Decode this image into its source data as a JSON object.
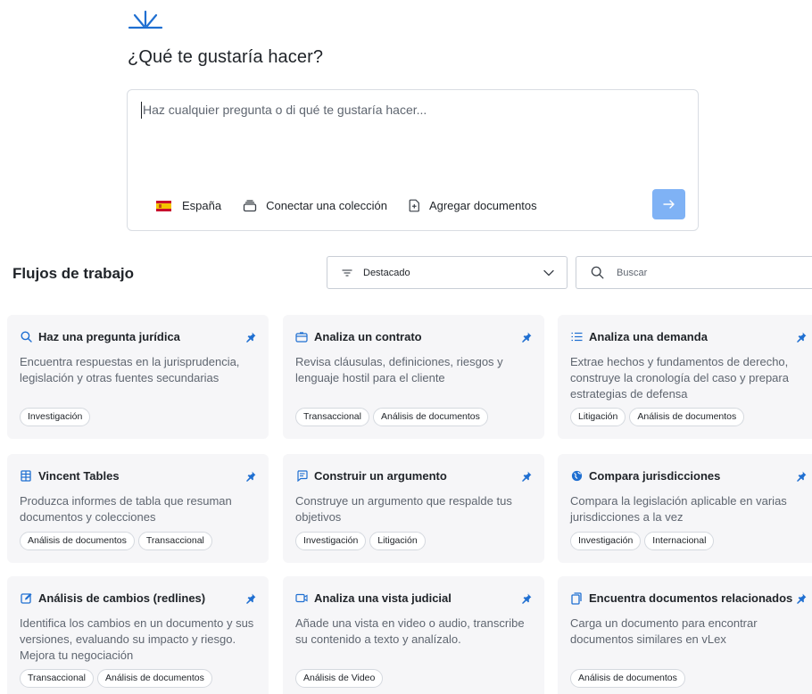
{
  "header": {
    "logo_icon": "vlex-spark-logo-icon",
    "title": "¿Qué te gustaría hacer?"
  },
  "prompt": {
    "placeholder": "Haz cualquier pregunta o di qué te gustaría hacer...",
    "tools": {
      "jurisdiction": "España",
      "collection": "Conectar una colección",
      "documents": "Agregar documentos"
    },
    "send_icon": "arrow-right-icon"
  },
  "workflows": {
    "title": "Flujos de trabajo",
    "sort": {
      "value": "Destacado",
      "icon": "filter-lines-icon"
    },
    "search": {
      "placeholder": "Buscar",
      "icon": "search-icon"
    },
    "cards": [
      {
        "title": "Haz una pregunta jurídica",
        "icon": "search-icon",
        "desc": "Encuentra respuestas en la jurisprudencia, legislación y otras fuentes secundarias",
        "tags": [
          "Investigación"
        ]
      },
      {
        "title": "Analiza un contrato",
        "icon": "contract-icon",
        "desc": "Revisa cláusulas, definiciones, riesgos y lenguaje hostil para el cliente",
        "tags": [
          "Transaccional",
          "Análisis de documentos"
        ]
      },
      {
        "title": "Analiza una demanda",
        "icon": "list-icon",
        "desc": "Extrae hechos y fundamentos de derecho, construye la cronología del caso y prepara estrategias de defensa",
        "tags": [
          "Litigación",
          "Análisis de documentos"
        ]
      },
      {
        "title": "Vincent Tables",
        "icon": "table-icon",
        "desc": "Produzca informes de tabla que resuman documentos y colecciones",
        "tags": [
          "Análisis de documentos",
          "Transaccional"
        ]
      },
      {
        "title": "Construir un argumento",
        "icon": "message-icon",
        "desc": "Construye un argumento que respalde tus objetivos",
        "tags": [
          "Investigación",
          "Litigación"
        ]
      },
      {
        "title": "Compara jurisdicciones",
        "icon": "globe-icon",
        "desc": "Compara la legislación aplicable en varias jurisdicciones a la vez",
        "tags": [
          "Investigación",
          "Internacional"
        ]
      },
      {
        "title": "Análisis de cambios (redlines)",
        "icon": "edit-icon",
        "desc": "Identifica los cambios en un documento y sus versiones, evaluando su impacto y riesgo. Mejora tu negociación",
        "tags": [
          "Transaccional",
          "Análisis de documentos"
        ]
      },
      {
        "title": "Analiza una vista judicial",
        "icon": "video-icon",
        "desc": "Añade una vista en video o audio, transcribe su contenido a texto y analízalo.",
        "tags": [
          "Análisis de Video"
        ]
      },
      {
        "title": "Encuentra documentos relacionados",
        "icon": "documents-icon",
        "desc": "Carga un documento para encontrar documentos similares en vLex",
        "tags": [
          "Análisis de documentos"
        ]
      }
    ]
  },
  "colors": {
    "accent": "#1f6fd1",
    "send_button": "#7fb2f5",
    "card_bg": "#f6f6f8"
  }
}
